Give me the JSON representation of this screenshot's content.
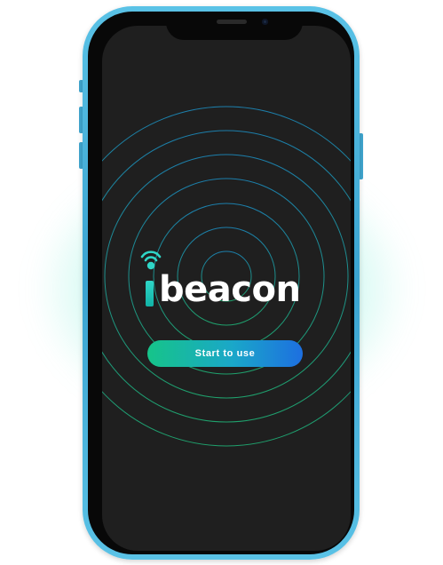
{
  "app": {
    "logo_text": "beacon",
    "logo_icon": "wifi-signal-icon",
    "start_button_label": "Start to use"
  },
  "device": {
    "frame_color": "#3fa6cf",
    "screen_color": "#1f1f1f"
  },
  "colors": {
    "accent_green": "#16c489",
    "accent_blue": "#1d6fe0",
    "ring_color": "#1aa7c9",
    "glow": "#48e6c8"
  }
}
